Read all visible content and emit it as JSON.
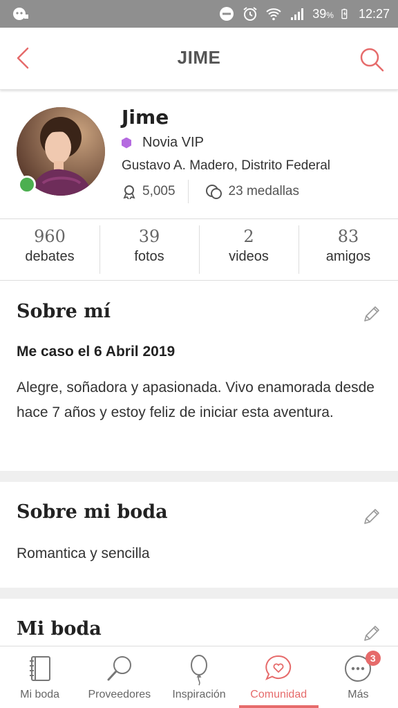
{
  "status_bar": {
    "battery": "39",
    "battery_unit": "%",
    "time": "12:27",
    "icons": [
      "notification-icon",
      "dnd-icon",
      "alarm-icon",
      "wifi-icon",
      "signal-icon",
      "battery-icon"
    ]
  },
  "app_bar": {
    "title": "JIME",
    "back_icon": "chevron-left-icon",
    "search_icon": "search-icon"
  },
  "profile": {
    "name": "Jime",
    "type": "Novia VIP",
    "location": "Gustavo A. Madero, Distrito Federal",
    "points": "5,005",
    "medals": "23 medallas",
    "online": true
  },
  "stats": [
    {
      "value": "960",
      "label": "debates"
    },
    {
      "value": "39",
      "label": "fotos"
    },
    {
      "value": "2",
      "label": "videos"
    },
    {
      "value": "83",
      "label": "amigos"
    }
  ],
  "about": {
    "title": "Sobre mí",
    "date": "Me caso el 6 Abril 2019",
    "text": "Alegre, soñadora y apasionada. Vivo enamorada desde hace 7 años y estoy feliz de iniciar esta aventura."
  },
  "wedding_about": {
    "title": "Sobre mi boda",
    "text": "Romantica y sencilla"
  },
  "my_wedding": {
    "title": "Mi boda"
  },
  "bottom_nav": {
    "items": [
      {
        "label": "Mi boda",
        "icon": "notebook-icon"
      },
      {
        "label": "Proveedores",
        "icon": "search-icon"
      },
      {
        "label": "Inspiración",
        "icon": "balloon-icon"
      },
      {
        "label": "Comunidad",
        "icon": "chat-heart-icon",
        "active": true
      },
      {
        "label": "Más",
        "icon": "more-icon",
        "badge": "3"
      }
    ]
  },
  "colors": {
    "accent": "#e66b6b",
    "vip": "#b56be0",
    "online": "#4caf50",
    "status_bar": "#8f8f8f"
  }
}
